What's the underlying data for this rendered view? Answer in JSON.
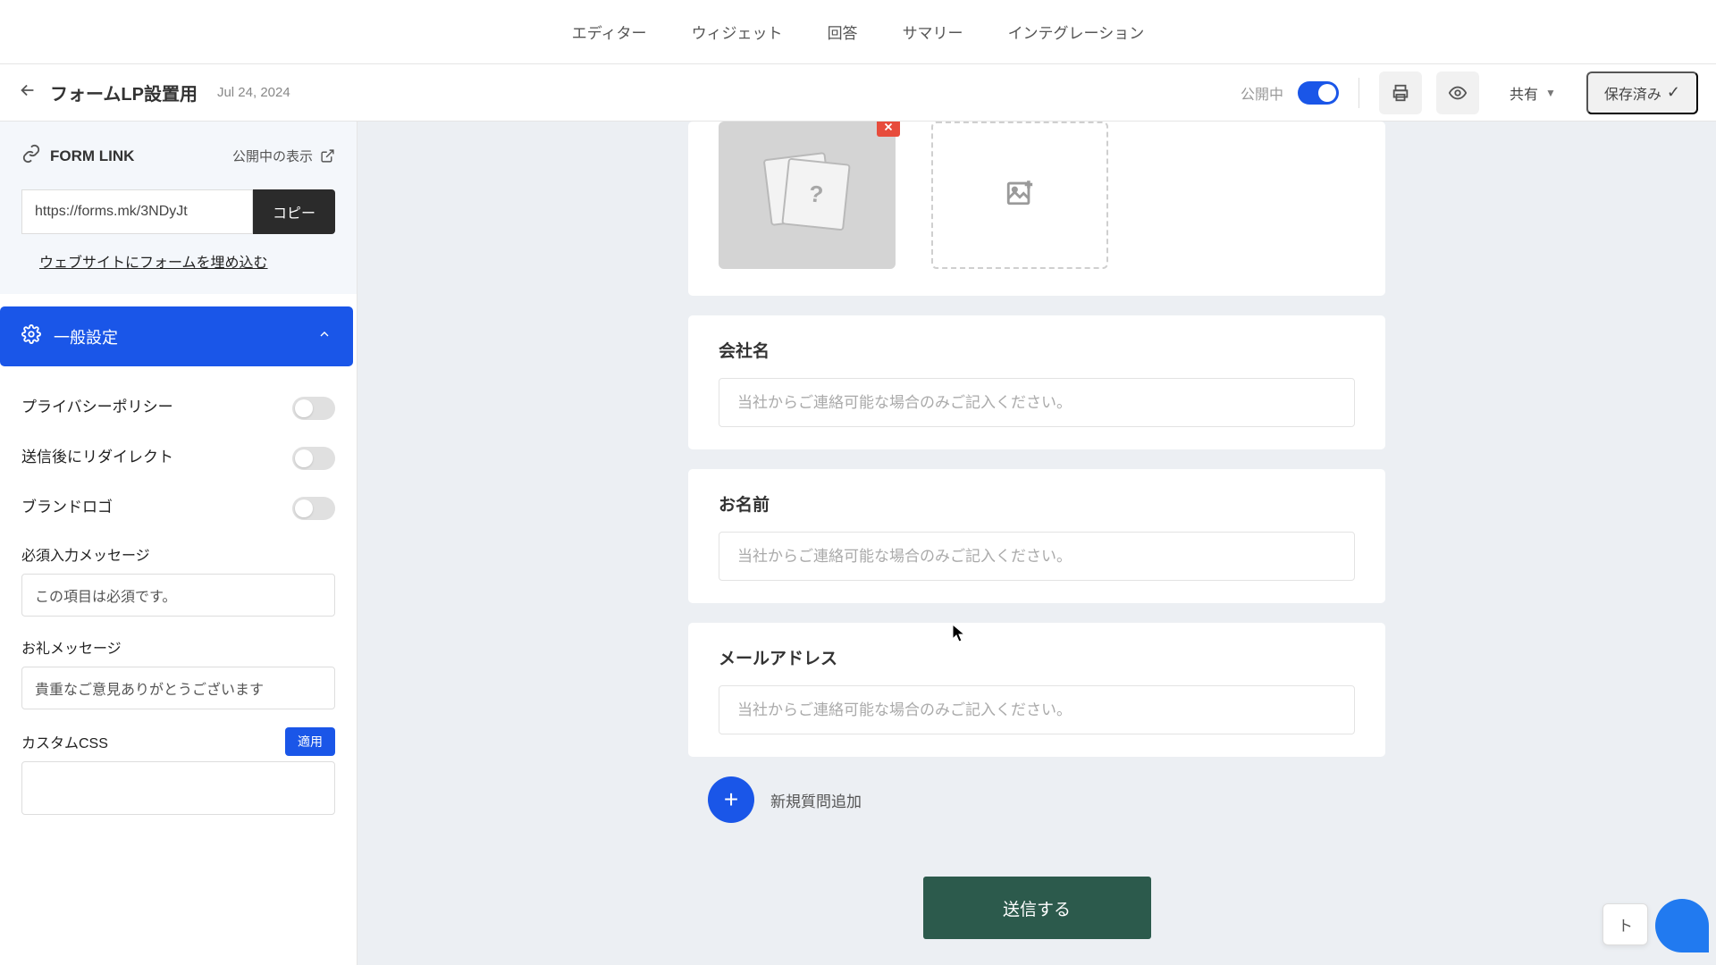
{
  "nav": {
    "items": [
      "エディター",
      "ウィジェット",
      "回答",
      "サマリー",
      "インテグレーション"
    ]
  },
  "header": {
    "title": "フォームLP設置用",
    "date": "Jul 24, 2024",
    "publish_label": "公開中",
    "share_label": "共有",
    "saved_label": "保存済み"
  },
  "sidebar": {
    "form_link_title": "FORM LINK",
    "view_published_label": "公開中の表示",
    "url_value": "https://forms.mk/3NDyJt",
    "copy_label": "コピー",
    "embed_label": "ウェブサイトにフォームを埋め込む",
    "section_general": "一般設定",
    "settings": [
      {
        "label": "プライバシーポリシー"
      },
      {
        "label": "送信後にリダイレクト"
      },
      {
        "label": "ブランドロゴ"
      }
    ],
    "required_msg_label": "必須入力メッセージ",
    "required_msg_value": "この項目は必須です。",
    "thanks_label": "お礼メッセージ",
    "thanks_value": "貴重なご意見ありがとうございます",
    "css_label": "カスタムCSS",
    "apply_label": "適用"
  },
  "form": {
    "questions": [
      {
        "label": "会社名",
        "placeholder": "当社からご連絡可能な場合のみご記入ください。"
      },
      {
        "label": "お名前",
        "placeholder": "当社からご連絡可能な場合のみご記入ください。"
      },
      {
        "label": "メールアドレス",
        "placeholder": "当社からご連絡可能な場合のみご記入ください。"
      }
    ],
    "add_question_label": "新規質問追加",
    "submit_label": "送信する"
  },
  "float": {
    "t_label": "ト"
  }
}
